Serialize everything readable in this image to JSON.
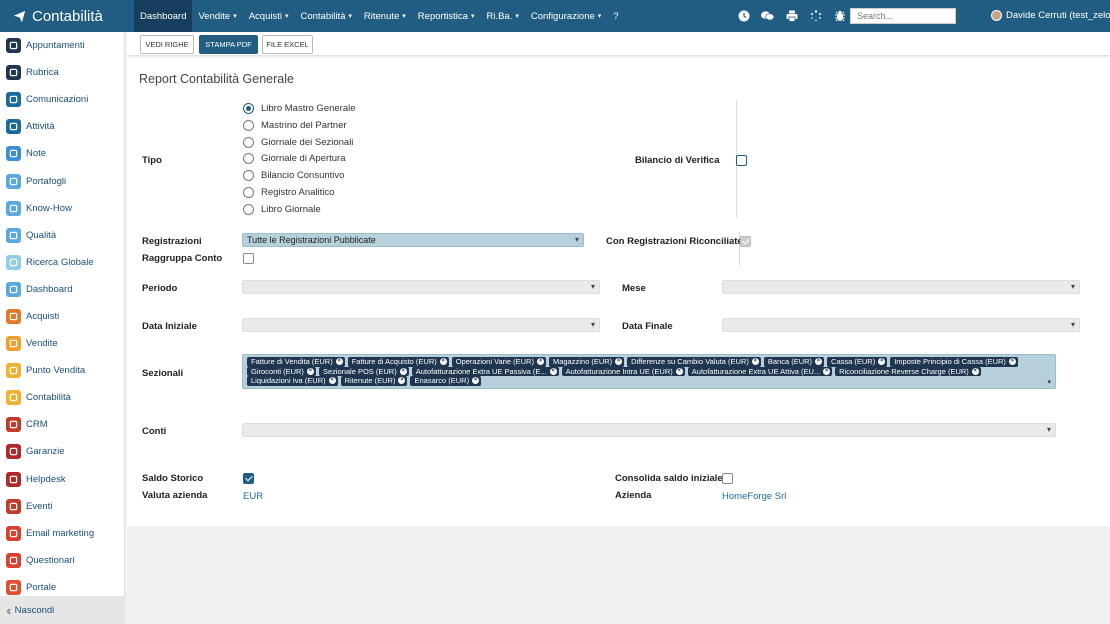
{
  "app": {
    "brand": "Contabilità",
    "search_placeholder": "Search...",
    "user": "Davide Cerruti (test_zelo)"
  },
  "menu": [
    {
      "label": "Dashboard",
      "caret": ""
    },
    {
      "label": "Vendite",
      "caret": "▾"
    },
    {
      "label": "Acquisti",
      "caret": "▾"
    },
    {
      "label": "Contabilità",
      "caret": "▾"
    },
    {
      "label": "Ritenute",
      "caret": "▾"
    },
    {
      "label": "Reportistica",
      "caret": "▾"
    },
    {
      "label": "Ri.Ba.",
      "caret": "▾"
    },
    {
      "label": "Configurazione",
      "caret": "▾"
    },
    {
      "label": "?",
      "caret": ""
    }
  ],
  "top_icons": [
    "clock-icon",
    "chat-icon",
    "print-icon",
    "spinner-icon",
    "bug-icon"
  ],
  "sidebar": {
    "items": [
      {
        "label": "Appuntamenti",
        "icon": "calendar-icon",
        "color": "#1f3550"
      },
      {
        "label": "Rubrica",
        "icon": "contacts-icon",
        "color": "#1f3550"
      },
      {
        "label": "Comunicazioni",
        "icon": "chat-bubble-icon",
        "color": "#1b6a9e"
      },
      {
        "label": "Attività",
        "icon": "checkbox-icon",
        "color": "#1b6a9e"
      },
      {
        "label": "Note",
        "icon": "note-icon",
        "color": "#3d8ed8"
      },
      {
        "label": "Portafogli",
        "icon": "wallet-icon",
        "color": "#5aa8e0"
      },
      {
        "label": "Know-How",
        "icon": "bulb-icon",
        "color": "#5aa8e0"
      },
      {
        "label": "Qualità",
        "icon": "quality-icon",
        "color": "#5aa8e0"
      },
      {
        "label": "Ricerca Globale",
        "icon": "search-icon",
        "color": "#8fd0e8"
      },
      {
        "label": "Dashboard",
        "icon": "dashboard-icon",
        "color": "#5aa8e0"
      },
      {
        "label": "Acquisti",
        "icon": "purchase-icon",
        "color": "#e07a2a"
      },
      {
        "label": "Vendite",
        "icon": "sales-icon",
        "color": "#f0a030"
      },
      {
        "label": "Punto Vendita",
        "icon": "pos-icon",
        "color": "#f0b030"
      },
      {
        "label": "Contabilità",
        "icon": "accounting-icon",
        "color": "#f0b030"
      },
      {
        "label": "CRM",
        "icon": "crm-icon",
        "color": "#c23a2a"
      },
      {
        "label": "Garanzie",
        "icon": "shield-icon",
        "color": "#b02a2a"
      },
      {
        "label": "Helpdesk",
        "icon": "headset-icon",
        "color": "#b02a2a"
      },
      {
        "label": "Eventi",
        "icon": "event-icon",
        "color": "#c23a2a"
      },
      {
        "label": "Email marketing",
        "icon": "send-icon",
        "color": "#d94030"
      },
      {
        "label": "Questionari",
        "icon": "survey-icon",
        "color": "#d94030"
      },
      {
        "label": "Portale",
        "icon": "portal-icon",
        "color": "#e05030"
      }
    ],
    "hide_label": "Nascondi"
  },
  "toolbar": {
    "btn_rows": "VEDI RIGHE",
    "btn_pdf": "STAMPA PDF",
    "btn_excel": "FILE EXCEL"
  },
  "form": {
    "title": "Report Contabilità Generale",
    "tipo_label": "Tipo",
    "tipo_options": [
      {
        "label": "Libro Mastro Generale",
        "selected": true
      },
      {
        "label": "Mastrino del Partner",
        "selected": false
      },
      {
        "label": "Giornale dei Sezionali",
        "selected": false
      },
      {
        "label": "Giornale di Apertura",
        "selected": false
      },
      {
        "label": "Bilancio Consuntivo",
        "selected": false
      },
      {
        "label": "Registro Analitico",
        "selected": false
      },
      {
        "label": "Libro Giornale",
        "selected": false
      }
    ],
    "bilancio_label": "Bilancio di Verifica",
    "registrazioni_label": "Registrazioni",
    "registrazioni_value": "Tutte le Registrazioni Pubblicate",
    "raggruppa_label": "Raggruppa Conto",
    "riconciliate_label": "Con Registrazioni Riconciliate",
    "periodo_label": "Periodo",
    "mese_label": "Mese",
    "data_iniziale_label": "Data Iniziale",
    "data_finale_label": "Data Finale",
    "sezionali_label": "Sezionali",
    "sezionali_tags": [
      "Fatture di Vendita (EUR)",
      "Fatture di Acquisto (EUR)",
      "Operazioni Varie (EUR)",
      "Magazzino (EUR)",
      "Differenze su Cambio Valuta (EUR)",
      "Banca (EUR)",
      "Cassa (EUR)",
      "Imposte Principio di Cassa (EUR)",
      "Giroconti (EUR)",
      "Sezionale POS (EUR)",
      "Autofatturazione Extra UE Passiva (E...",
      "Autofatturazione Intra UE (EUR)",
      "Autofatturazione Extra UE Attiva (EU...",
      "Riconciliazione Reverse Charge (EUR)",
      "Liquidazioni Iva (EUR)",
      "Ritenute (EUR)",
      "Enasarco (EUR)"
    ],
    "conti_label": "Conti",
    "saldo_storico_label": "Saldo Storico",
    "consolida_label": "Consolida saldo iniziale",
    "valuta_label": "Valuta azienda",
    "valuta_value": "EUR",
    "azienda_label": "Azienda",
    "azienda_value": "HomeForge Srl",
    "caret": "▾"
  }
}
